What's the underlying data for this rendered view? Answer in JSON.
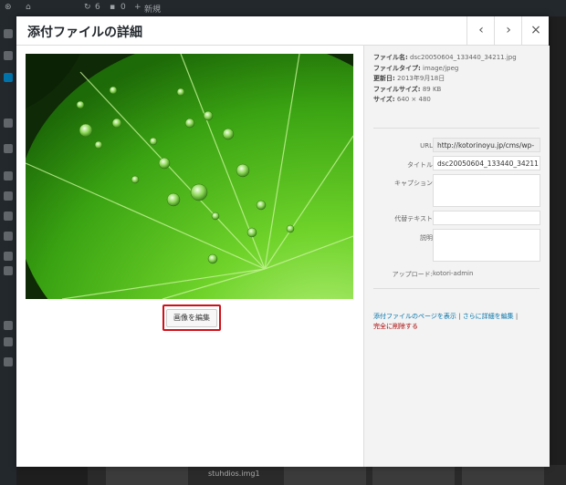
{
  "adminbar": {
    "updates_count": "6",
    "comments_count": "0",
    "new_label": "新規"
  },
  "background": {
    "thumb_filename": "stuhdios.img1"
  },
  "modal": {
    "title": "添付ファイルの詳細",
    "prev_icon": "chevron-left-icon",
    "next_icon": "chevron-right-icon",
    "close_icon": "close-icon",
    "prev_glyph": "‹",
    "next_glyph": "›",
    "close_glyph": "×"
  },
  "media": {
    "edit_image_label": "画像を編集",
    "highlight_color": "#d0101a"
  },
  "file_info": {
    "filename_label": "ファイル名:",
    "filename": "dsc20050604_133440_34211.jpg",
    "filetype_label": "ファイルタイプ:",
    "filetype": "image/jpeg",
    "uploaded_label": "更新日:",
    "uploaded": "2013年9月18日",
    "filesize_label": "ファイルサイズ:",
    "filesize": "89 KB",
    "dimensions_label": "サイズ:",
    "dimensions": "640 × 480"
  },
  "fields": {
    "url_label": "URL",
    "url_value": "http://kotorinoyu.jp/cms/wp-",
    "title_label": "タイトル",
    "title_value": "dsc20050604_133440_34211",
    "caption_label": "キャプション",
    "caption_value": "",
    "alt_label": "代替テキスト",
    "alt_value": "",
    "description_label": "説明",
    "description_value": "",
    "uploaded_by_label": "アップロード:",
    "uploaded_by": "kotori-admin"
  },
  "actions": {
    "view_page": "添付ファイルのページを表示",
    "separator": " | ",
    "edit_more": "さらに詳細を編集",
    "separator2": " |",
    "delete": "完全に削除する"
  }
}
